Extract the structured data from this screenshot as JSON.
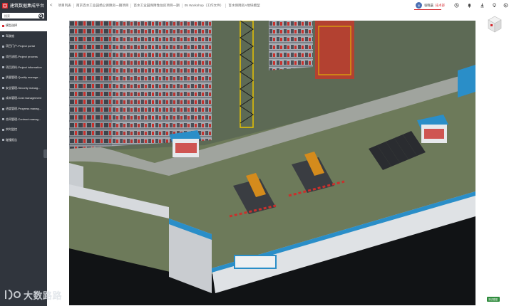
{
  "app": {
    "title": "建筑数据集成平台"
  },
  "sidebar": {
    "search_placeholder": "搜索",
    "items": [
      {
        "label": "模型选择",
        "active": true
      },
      {
        "label": "驾驶舱",
        "active": false
      },
      {
        "label": "项目门户-Project portal",
        "active": false
      },
      {
        "label": "项目流程-Project process",
        "active": false
      },
      {
        "label": "项目资料-Project information",
        "active": false
      },
      {
        "label": "质量管理-Quality manage...",
        "active": false
      },
      {
        "label": "安全管理-Security manag...",
        "active": false
      },
      {
        "label": "成本管理-Cost management",
        "active": false
      },
      {
        "label": "进度管理-Progress manag...",
        "active": false
      },
      {
        "label": "合同管理-Contract manag...",
        "active": false
      },
      {
        "label": "实时监控",
        "active": false
      },
      {
        "label": "碰撞报告",
        "active": false
      }
    ]
  },
  "header": {
    "back_label": "<",
    "breadcrumbs": [
      "项目列表",
      "南京百水工业园扬尘保障房一期项目",
      "百水工业园保障性住房项目一期",
      "05 Workshop（工作文件）",
      "百水保障房A地块模型"
    ],
    "user": {
      "avatar_text": "张",
      "name": "张晓晨",
      "role": "技术部"
    },
    "icons": [
      "clock-icon",
      "bell-icon",
      "download-icon",
      "lightbulb-icon",
      "settings-icon"
    ]
  },
  "viewport": {
    "badge": "测试模型"
  },
  "watermark": {
    "text": "大数路路"
  },
  "colors": {
    "accent": "#d5262c",
    "sidebar_bg": "#30353d"
  }
}
